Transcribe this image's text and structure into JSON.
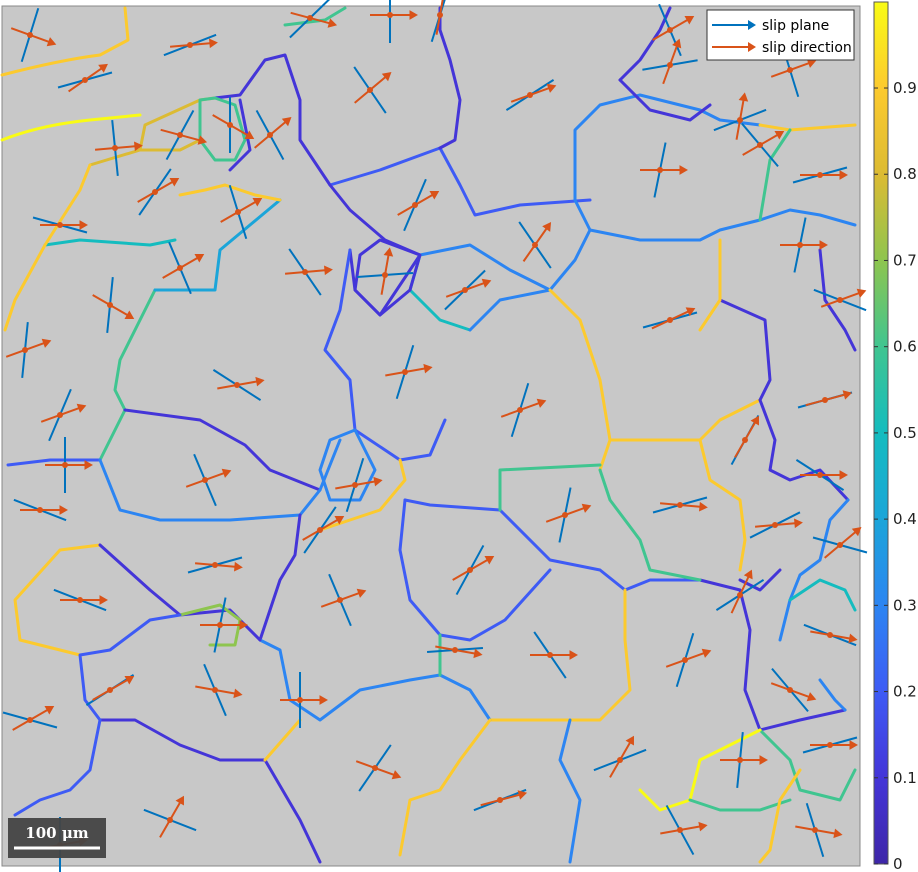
{
  "legend": {
    "items": [
      {
        "label": "slip plane",
        "color": "#0072BD"
      },
      {
        "label": "slip direction",
        "color": "#D95319"
      }
    ]
  },
  "colorbar": {
    "ticks": [
      "0.9",
      "0.8",
      "0.7",
      "0.6",
      "0.5",
      "0.4",
      "0.3",
      "0.2",
      "0.1",
      "0"
    ],
    "colormap": "parula",
    "range": [
      0,
      1
    ]
  },
  "scalebar": {
    "label": "100 μm"
  },
  "colors": {
    "map_background": "#c8c8c8",
    "slip_plane": "#0072BD",
    "slip_direction": "#D95319"
  }
}
